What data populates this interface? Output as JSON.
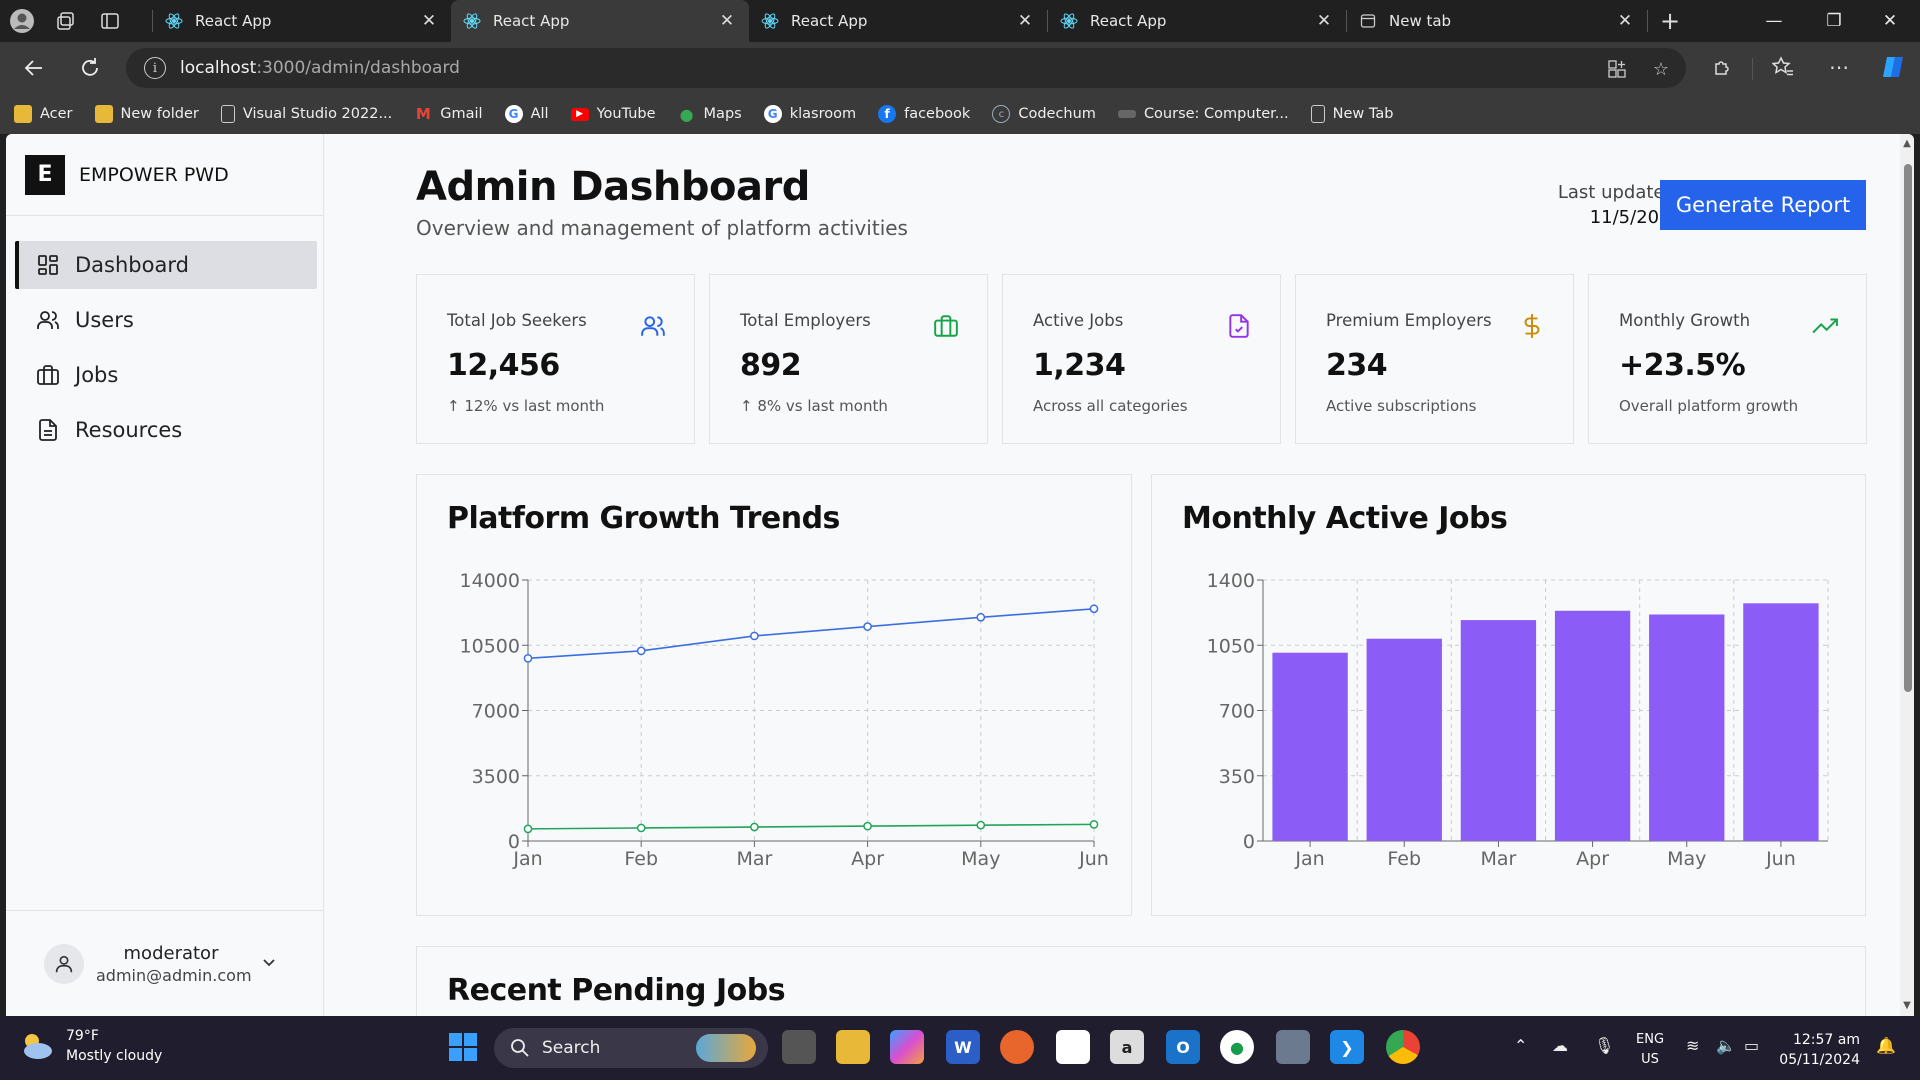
{
  "browser": {
    "tabs": [
      {
        "title": "React App",
        "active": false
      },
      {
        "title": "React App",
        "active": true
      },
      {
        "title": "React App",
        "active": false
      },
      {
        "title": "React App",
        "active": false
      },
      {
        "title": "New tab",
        "active": false
      }
    ],
    "url_host": "localhost",
    "url_path": ":3000/admin/dashboard",
    "bookmarks": [
      "Acer",
      "New folder",
      "Visual Studio 2022...",
      "Gmail",
      "All",
      "YouTube",
      "Maps",
      "klasroom",
      "facebook",
      "Codechum",
      "Course: Computer...",
      "New Tab"
    ]
  },
  "sidebar": {
    "logo_letter": "E",
    "brand": "EMPOWER PWD",
    "items": [
      {
        "label": "Dashboard",
        "icon": "dashboard-grid-icon",
        "active": true
      },
      {
        "label": "Users",
        "icon": "users-icon",
        "active": false
      },
      {
        "label": "Jobs",
        "icon": "briefcase-icon",
        "active": false
      },
      {
        "label": "Resources",
        "icon": "document-icon",
        "active": false
      }
    ],
    "user": {
      "name": "moderator",
      "email": "admin@admin.com"
    }
  },
  "header": {
    "title": "Admin Dashboard",
    "subtitle": "Overview and management of platform activities",
    "last_updated_label": "Last updated:",
    "last_updated_date": "11/5/2024",
    "generate_button": "Generate Report"
  },
  "stats": [
    {
      "label": "Total Job Seekers",
      "value": "12,456",
      "sub": "↑ 12% vs last month",
      "icon": "users-icon",
      "color": "#2563eb"
    },
    {
      "label": "Total Employers",
      "value": "892",
      "sub": "↑ 8% vs last month",
      "icon": "briefcase-icon",
      "color": "#16a34a"
    },
    {
      "label": "Active Jobs",
      "value": "1,234",
      "sub": "Across all categories",
      "icon": "file-check-icon",
      "color": "#9333ea"
    },
    {
      "label": "Premium Employers",
      "value": "234",
      "sub": "Active subscriptions",
      "icon": "dollar-icon",
      "color": "#ca8a04"
    },
    {
      "label": "Monthly Growth",
      "value": "+23.5%",
      "sub": "Overall platform growth",
      "icon": "trending-up-icon",
      "color": "#16a34a"
    }
  ],
  "chart_data": [
    {
      "type": "line",
      "title": "Platform Growth Trends",
      "categories": [
        "Jan",
        "Feb",
        "Mar",
        "Apr",
        "May",
        "Jun"
      ],
      "series": [
        {
          "color": "#3b6fe0",
          "values": [
            9800,
            10200,
            11000,
            11500,
            12000,
            12456
          ]
        },
        {
          "color": "#22a55a",
          "values": [
            650,
            700,
            750,
            800,
            850,
            892
          ]
        }
      ],
      "yticks": [
        0,
        3500,
        7000,
        10500,
        14000
      ],
      "ylim": [
        0,
        14000
      ],
      "grid": true
    },
    {
      "type": "bar",
      "title": "Monthly Active Jobs",
      "categories": [
        "Jan",
        "Feb",
        "Mar",
        "Apr",
        "May",
        "Jun"
      ],
      "values": [
        1010,
        1085,
        1185,
        1235,
        1215,
        1275
      ],
      "color": "#8b5cf6",
      "yticks": [
        0,
        350,
        700,
        1050,
        1400
      ],
      "ylim": [
        0,
        1400
      ],
      "grid": true
    }
  ],
  "pending": {
    "title": "Recent Pending Jobs"
  },
  "taskbar": {
    "weather_temp": "79°F",
    "weather_desc": "Mostly cloudy",
    "search_label": "Search",
    "lang1": "ENG",
    "lang2": "US",
    "time": "12:57 am",
    "date": "05/11/2024"
  }
}
